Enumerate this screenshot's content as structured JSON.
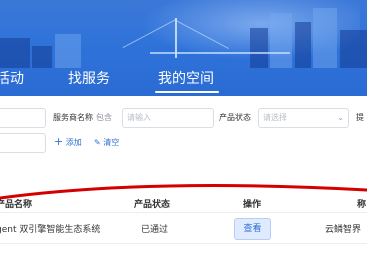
{
  "nav": {
    "items": [
      {
        "label": "活动",
        "active": false
      },
      {
        "label": "找服务",
        "active": false
      },
      {
        "label": "我的空间",
        "active": true
      }
    ]
  },
  "filters": {
    "service_name_label": "服务商名称",
    "service_name_qualifier": "包含",
    "service_name_placeholder": "请输入",
    "status_label": "产品状态",
    "status_placeholder": "请选择",
    "submit_label_partial": "提"
  },
  "actions": {
    "add_label": "添加",
    "clear_label": "清空"
  },
  "table": {
    "headers": {
      "product_name": "产品名称",
      "product_status": "产品状态",
      "operation": "操作",
      "extra": "称"
    },
    "rows": [
      {
        "product_name": "gent 双引擎智能生态系统",
        "status": "已通过",
        "action": "查看",
        "provider": "云鳞智界"
      }
    ]
  },
  "colors": {
    "banner": "#2f73d9",
    "accent": "#2f6fd6",
    "annotation": "#d40000"
  }
}
